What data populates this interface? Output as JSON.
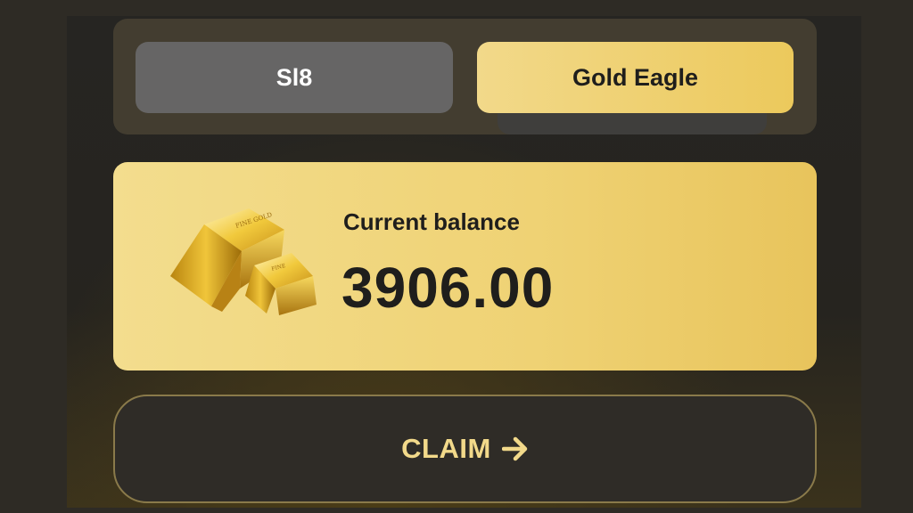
{
  "tabs": [
    {
      "label": "Sl8",
      "selected": false
    },
    {
      "label": "Gold Eagle",
      "selected": true
    }
  ],
  "balance": {
    "label": "Current balance",
    "value": "3906.00",
    "icon": "gold-bars-icon"
  },
  "claim": {
    "label": "CLAIM",
    "icon": "arrow-right-icon"
  },
  "colors": {
    "accent_gold": "#ecc95c",
    "tab_inactive": "#666565",
    "background": "#26241f"
  }
}
